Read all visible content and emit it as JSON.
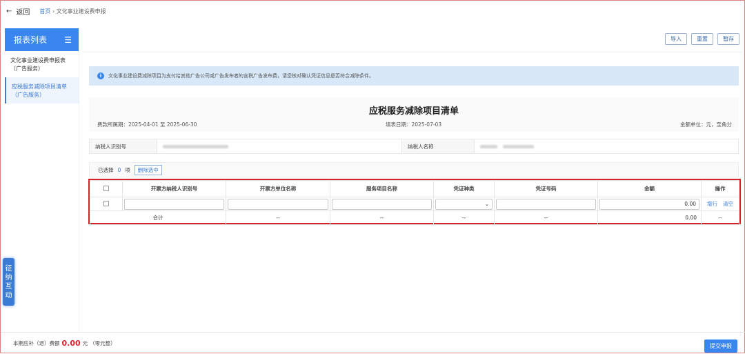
{
  "topbar": {
    "back": "返回",
    "crumb_home": "首页",
    "crumb_sep": "›",
    "crumb_current": "文化事业建设费申报"
  },
  "sidebar": {
    "title": "报表列表",
    "menu_icon": "☰",
    "items": [
      {
        "label": "文化事业建设费申报表",
        "sub": "（广告服务）"
      },
      {
        "label": "应税服务减除项目清单",
        "sub": "（广告服务）"
      }
    ]
  },
  "toolbar": {
    "import": "导入",
    "reset": "重置",
    "save": "暂存"
  },
  "info": {
    "icon": "i",
    "text": "文化事业建设费减除项目为支付给其他广告公司或广告发布者的含税广告发布费，请您核对确认凭证信息是否符合减除条件。"
  },
  "form": {
    "title": "应税服务减除项目清单",
    "period_label": "费款所属期：",
    "period": "2025-04-01 至 2025-06-30",
    "fill_label": "填表日期：",
    "fill_date": "2025-07-03",
    "unit": "金额单位：元，至角分"
  },
  "taxpayer": {
    "id_label": "纳税人识别号",
    "name_label": "纳税人名称"
  },
  "selection": {
    "prefix": "已选择",
    "count": "0",
    "suffix": "项",
    "delete": "删除选中"
  },
  "table": {
    "headers": [
      "开票方纳税人识别号",
      "开票方单位名称",
      "服务项目名称",
      "凭证种类",
      "凭证号码",
      "金额",
      "操作"
    ],
    "row": {
      "amount": "0.00",
      "add": "增行",
      "clear": "清空"
    },
    "total": {
      "label": "合计",
      "dash": "--",
      "amount": "0.00"
    }
  },
  "float_tab": [
    "征",
    "纳",
    "互",
    "动"
  ],
  "footer": {
    "label": "本期应补（退）费额",
    "amount": "0.00",
    "unit": "元",
    "words": "（零元整）",
    "submit": "提交申报"
  },
  "colors": {
    "primary": "#3a86f0",
    "highlight": "#d4232b"
  }
}
